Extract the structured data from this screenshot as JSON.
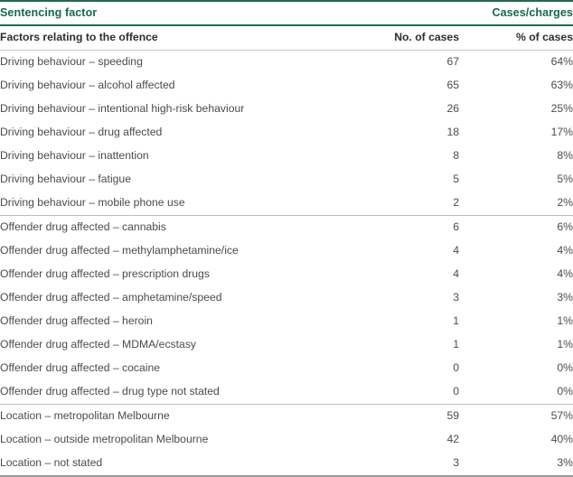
{
  "table": {
    "header": {
      "factor_label": "Sentencing factor",
      "cases_charges_label": "Cases/charges"
    },
    "subheader": {
      "factor_label": "Factors relating to the offence",
      "no_of_cases_label": "No. of cases",
      "pct_of_cases_label": "% of cases"
    },
    "colors": {
      "header_green": "#136a4d",
      "header_rule": "#1c6b50",
      "body_text": "#4b4b4b",
      "subheader_text": "#2e2e2e",
      "divider": "#bdbdbd",
      "bottom_rule": "#9a9a9a"
    },
    "groups": [
      {
        "name": "driving-behaviour",
        "rows": [
          {
            "factor": "Driving behaviour – speeding",
            "cases": "67",
            "pct": "64%"
          },
          {
            "factor": "Driving behaviour – alcohol affected",
            "cases": "65",
            "pct": "63%"
          },
          {
            "factor": "Driving behaviour – intentional high-risk behaviour",
            "cases": "26",
            "pct": "25%"
          },
          {
            "factor": "Driving behaviour – drug affected",
            "cases": "18",
            "pct": "17%"
          },
          {
            "factor": "Driving behaviour – inattention",
            "cases": "8",
            "pct": "8%"
          },
          {
            "factor": "Driving behaviour – fatigue",
            "cases": "5",
            "pct": "5%"
          },
          {
            "factor": "Driving behaviour – mobile phone use",
            "cases": "2",
            "pct": "2%"
          }
        ]
      },
      {
        "name": "offender-drug-affected",
        "rows": [
          {
            "factor": "Offender drug affected – cannabis",
            "cases": "6",
            "pct": "6%"
          },
          {
            "factor": "Offender drug affected – methylamphetamine/ice",
            "cases": "4",
            "pct": "4%"
          },
          {
            "factor": "Offender drug affected – prescription drugs",
            "cases": "4",
            "pct": "4%"
          },
          {
            "factor": "Offender drug affected – amphetamine/speed",
            "cases": "3",
            "pct": "3%"
          },
          {
            "factor": "Offender drug affected – heroin",
            "cases": "1",
            "pct": "1%"
          },
          {
            "factor": "Offender drug affected – MDMA/ecstasy",
            "cases": "1",
            "pct": "1%"
          },
          {
            "factor": "Offender drug affected – cocaine",
            "cases": "0",
            "pct": "0%"
          },
          {
            "factor": "Offender drug affected – drug type not stated",
            "cases": "0",
            "pct": "0%"
          }
        ]
      },
      {
        "name": "location",
        "rows": [
          {
            "factor": "Location – metropolitan Melbourne",
            "cases": "59",
            "pct": "57%"
          },
          {
            "factor": "Location – outside metropolitan Melbourne",
            "cases": "42",
            "pct": "40%"
          },
          {
            "factor": "Location – not stated",
            "cases": "3",
            "pct": "3%"
          }
        ]
      }
    ]
  }
}
